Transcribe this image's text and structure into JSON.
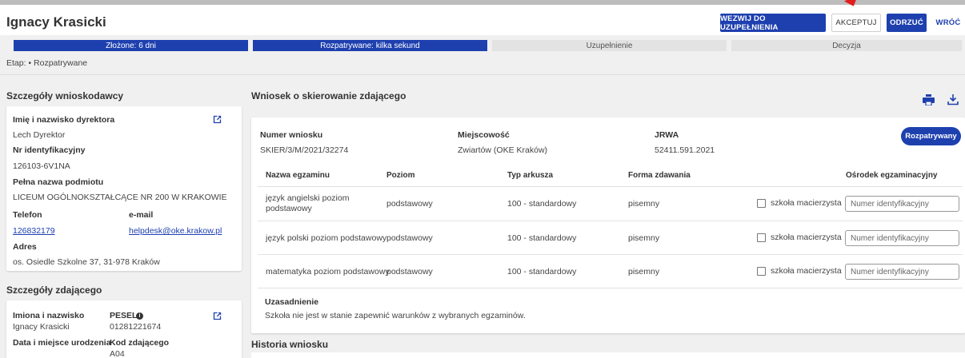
{
  "header": {
    "title": "Ignacy Krasicki",
    "buttons": {
      "call_to_complete": "WEZWIJ DO UZUPEŁNIENIA",
      "accept": "AKCEPTUJ",
      "reject": "ODRZUĆ",
      "back": "WRÓĆ"
    }
  },
  "progress": [
    {
      "label": "Złożone: 6 dni",
      "state": "done"
    },
    {
      "label": "Rozpatrywane: kilka sekund",
      "state": "done"
    },
    {
      "label": "Uzupełnienie",
      "state": "pending"
    },
    {
      "label": "Decyzja",
      "state": "pending"
    }
  ],
  "stage": "Etap: • Rozpatrywane",
  "applicant": {
    "section_title": "Szczegóły wnioskodawcy",
    "director_label": "Imię i nazwisko dyrektora",
    "director_value": "Lech Dyrektor",
    "id_label": "Nr identyfikacyjny",
    "id_value": "126103-6V1NA",
    "entity_label": "Pełna nazwa podmiotu",
    "entity_value": "LICEUM OGÓLNOKSZTAŁCĄCE NR 200 W KRAKOWIE",
    "phone_label": "Telefon",
    "phone_value": "126832179",
    "email_label": "e-mail",
    "email_value": "helpdesk@oke.krakow.pl",
    "address_label": "Adres",
    "address_value": "os. Osiedle Szkolne 37, 31-978 Kraków"
  },
  "student": {
    "section_title": "Szczegóły zdającego",
    "name_label": "Imiona i nazwisko",
    "name_value": "Ignacy Krasicki",
    "pesel_label": "PESEL",
    "pesel_value": "01281221674",
    "birth_label": "Data i miejsce urodzenia",
    "code_label": "Kod zdającego",
    "code_value": "A04"
  },
  "application": {
    "section_title": "Wniosek o skierowanie zdającego",
    "number_label": "Numer wniosku",
    "number_value": "SKIER/3/M/2021/32274",
    "city_label": "Miejscowość",
    "city_value": "Zwiartów (OKE Kraków)",
    "jrwa_label": "JRWA",
    "jrwa_value": "52411.591.2021",
    "status": "Rozpatrywany",
    "columns": [
      "Nazwa egzaminu",
      "Poziom",
      "Typ arkusza",
      "Forma zdawania",
      "Ośrodek egzaminacyjny"
    ],
    "rows": [
      {
        "exam": "język angielski poziom podstawowy",
        "level": "podstawowy",
        "sheet": "100 - standardowy",
        "form": "pisemny",
        "checkbox_label": "szkoła macierzysta",
        "placeholder": "Numer identyfikacyjny"
      },
      {
        "exam": "język polski poziom podstawowy",
        "level": "podstawowy",
        "sheet": "100 - standardowy",
        "form": "pisemny",
        "checkbox_label": "szkoła macierzysta",
        "placeholder": "Numer identyfikacyjny"
      },
      {
        "exam": "matematyka poziom podstawowy",
        "level": "podstawowy",
        "sheet": "100 - standardowy",
        "form": "pisemny",
        "checkbox_label": "szkoła macierzysta",
        "placeholder": "Numer identyfikacyjny"
      }
    ],
    "justification_label": "Uzasadnienie",
    "justification_value": "Szkoła nie jest w stanie zapewnić warunków z wybranych egzaminów."
  },
  "history": {
    "section_title": "Historia wniosku"
  },
  "colors": {
    "primary": "#1e40af",
    "alert_arrow": "#e11d1d"
  }
}
